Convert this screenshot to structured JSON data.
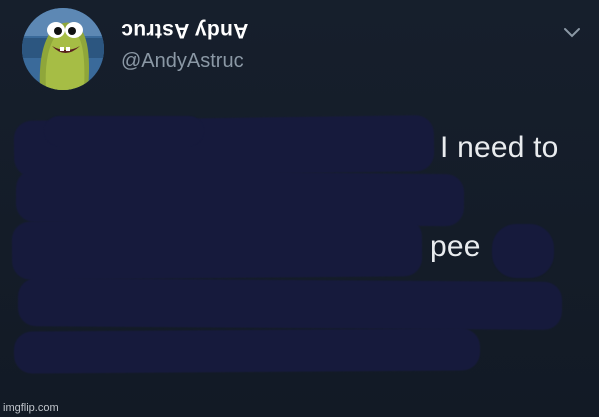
{
  "tweet": {
    "display_name": "Andy Astruc",
    "handle": "@AndyAstruc",
    "text_line_1": "I need to",
    "text_line_2": "pee"
  },
  "icons": {
    "menu": "chevron-down-icon",
    "avatar": "avatar-image"
  },
  "watermark": "imgflip.com",
  "colors": {
    "background": "#15202b",
    "handle_gray": "#8b98a5",
    "redaction_navy": "#161a3c"
  }
}
